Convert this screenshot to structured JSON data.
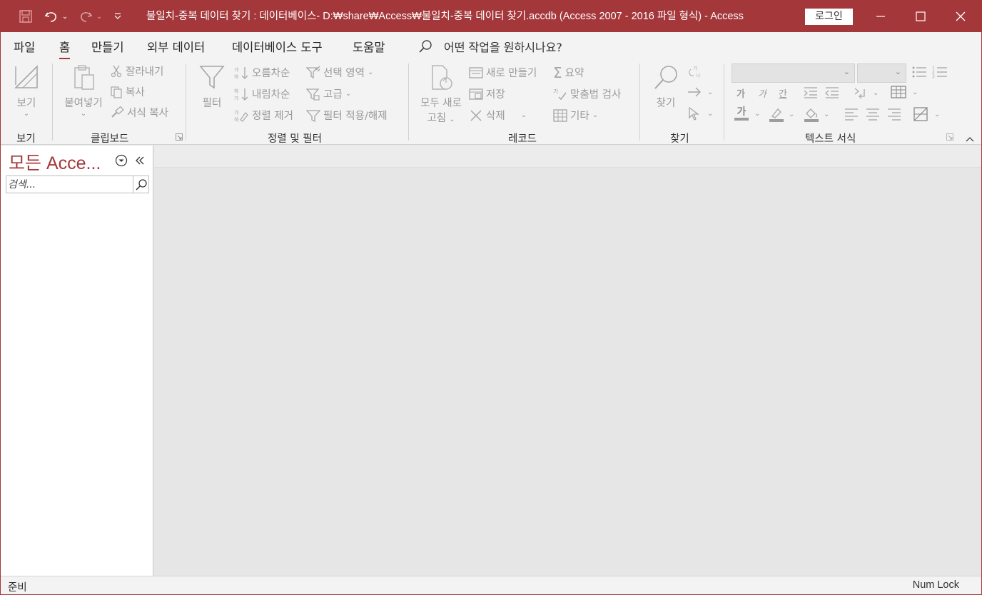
{
  "app": {
    "title": "불일치-중복 데이터 찾기 : 데이터베이스- D:₩share₩Access₩불일치-중복 데이터 찾기.accdb (Access 2007 - 2016 파일 형식)  -  Access",
    "login_label": "로그인",
    "accent_color": "#a4373a"
  },
  "quick_access": {
    "save_icon": "save-icon",
    "undo_icon": "undo-icon",
    "redo_icon": "redo-icon",
    "customize_icon": "customize-icon"
  },
  "tabs": [
    {
      "label": "파일",
      "active": false
    },
    {
      "label": "홈",
      "active": true
    },
    {
      "label": "만들기",
      "active": false
    },
    {
      "label": "외부 데이터",
      "active": false
    },
    {
      "label": "데이터베이스 도구",
      "active": false
    },
    {
      "label": "도움말",
      "active": false
    }
  ],
  "tell_me": {
    "placeholder": "어떤 작업을 원하시나요?"
  },
  "ribbon": {
    "views": {
      "group": "보기",
      "view": "보기"
    },
    "clipboard": {
      "group": "클립보드",
      "paste": "붙여넣기",
      "cut": "잘라내기",
      "copy": "복사",
      "format_painter": "서식 복사"
    },
    "sort_filter": {
      "group": "정렬 및 필터",
      "filter": "필터",
      "ascending": "오름차순",
      "descending": "내림차순",
      "remove_sort": "정렬 제거",
      "selection": "선택 영역",
      "advanced": "고급",
      "toggle_filter": "필터 적용/해제"
    },
    "records": {
      "group": "레코드",
      "refresh_all_line1": "모두 새로",
      "refresh_all_line2": "고침",
      "new": "새로 만들기",
      "save": "저장",
      "delete": "삭제",
      "totals": "요약",
      "spelling": "맞춤법 검사",
      "more": "기타"
    },
    "find": {
      "group": "찾기",
      "find": "찾기",
      "replace_glyph": "가나"
    },
    "text_formatting": {
      "group": "텍스트 서식",
      "bold": "가",
      "italic": "가",
      "underline": "간",
      "font_color_glyph": "가"
    }
  },
  "nav_pane": {
    "title": "모든 Acce...",
    "search_placeholder": "검색..."
  },
  "status": {
    "left": "준비",
    "right": "Num Lock"
  }
}
